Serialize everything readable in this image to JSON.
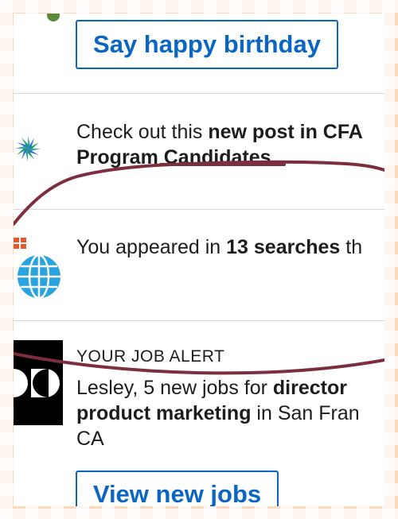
{
  "birthday": {
    "button_label": "Say happy birthday"
  },
  "post_notice": {
    "prefix": "Check out this ",
    "bold": "new post in CFA",
    "line2": "Program Candidates"
  },
  "search_notice": {
    "prefix": "You appeared in ",
    "bold": "13 searches",
    "suffix": " th"
  },
  "job_alert": {
    "label": "YOUR JOB ALERT",
    "line1_prefix": "Lesley, 5 new jobs for ",
    "line1_bold": "director",
    "line2_bold": "product marketing",
    "line2_suffix": " in San Fran",
    "line3": "CA",
    "button_label": "View new jobs"
  },
  "colors": {
    "accent": "#0a66c2",
    "scribble": "#7b2f3e"
  }
}
